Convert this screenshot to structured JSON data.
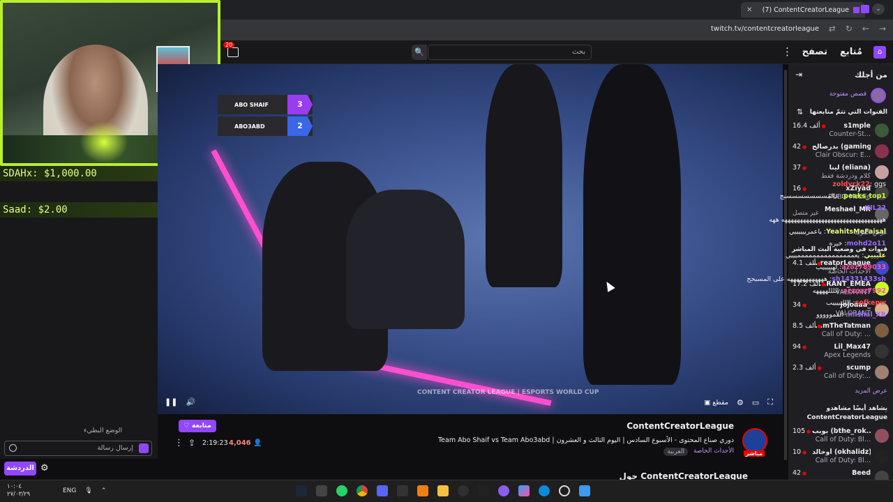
{
  "browser": {
    "tab_title": "(7) ContentCreatorLeague",
    "url": "twitch.tv/contentcreatorleague"
  },
  "topnav": {
    "following": "مُتابع",
    "browse": "تصفح",
    "search_placeholder": "بحث",
    "notif_count": "20"
  },
  "overlay": {
    "donation1": "SDAHx: $1,000.00",
    "donation2": "Saad: $2.00"
  },
  "scoreboard": [
    {
      "team": "ABO SHAIF",
      "score": "3"
    },
    {
      "team": "ABO3ABD",
      "score": "2"
    }
  ],
  "chat": {
    "messages": [
      {
        "user": "zoldyck22",
        "text": "ggs",
        "color": "#ff4f4f"
      },
      {
        "user": "peaks_top1",
        "text": "عالمسسسسسسسبح",
        "color": "#c8ff40"
      },
      {
        "user": "INL22",
        "text": "",
        "color": "#9b6bff"
      },
      {
        "user": "",
        "text": "هههههههههههههههههههههههههههههههههه ههه",
        "color": "#efeff1"
      },
      {
        "user": "YeahitsMeFaisal",
        "text": "ياعمرييييييي",
        "color": "#e6ff80"
      },
      {
        "user": "mohd2o11",
        "text": "خيره",
        "color": "#9b6bff"
      },
      {
        "user": "عليييي",
        "text": "يعممممممممممممممميييي",
        "color": "#e6ff80"
      },
      {
        "user": "azoz789033",
        "text": "لهيييييب",
        "color": "#ff4fa8"
      },
      {
        "user": "sh14331433sh",
        "text": "ههههههههههههه على المسبحح",
        "color": "#9b6bff"
      },
      {
        "user": "azzozz7992",
        "text": "اللللههههه",
        "color": "#ff4fa8"
      },
      {
        "user": "sofkepw",
        "text": "اللليييييب",
        "color": "#ff4f4f"
      },
      {
        "user": "mishal_XR",
        "text": "القمووووو",
        "color": "#9b6bff"
      }
    ],
    "mode_label": "الوضع البطيء",
    "input_placeholder": "إرسال رسالة",
    "chat_button": "الدردشة"
  },
  "player": {
    "clip_label": "مقطع",
    "watermark": "CONTENT CREATOR LEAGUE | ESPORTS WORLD CUP"
  },
  "stream": {
    "channel": "ContentCreatorLeague",
    "title": "دوري صناع المحتوى - الأسبوع السادس | اليوم الثالث و العشرون | Team Abo Shaif vs Team Abo3abd",
    "category": "الأحداث الخاصة",
    "tag": "العربية",
    "live_badge": "مباشر",
    "follow_label": "متابعة",
    "viewers": "4,046",
    "uptime": "2:19:23",
    "about": "حول ContentCreatorLeague"
  },
  "sidebar": {
    "for_you": "من أجلك",
    "open_stories": "قصص مفتوحة",
    "followed_heading": "القنوات التي تتمّ متابعتها",
    "followed": [
      {
        "name": "s1mple",
        "game": "Counter-St...",
        "viewers": "16.4 ألف",
        "color": "#3a5a3a"
      },
      {
        "name": "بدرصالح (gaming)...",
        "game": "Clair Obscur: E...",
        "viewers": "42",
        "color": "#8a3050"
      },
      {
        "name": "لينا (eliana)",
        "game": "كلام ودردشة فقط",
        "viewers": "37",
        "color": "#c8a0a0"
      },
      {
        "name": "xZiyad",
        "game": "PUBG Mobile",
        "viewers": "16",
        "color": "#444"
      },
      {
        "name": "Meshael_MR",
        "game": "",
        "viewers": "",
        "offline": "غير متصل",
        "color": "#666"
      }
    ],
    "show_more": "عرض المزيد",
    "live_heading": "قنوات في وضعية البث المباشر",
    "live": [
      {
        "name": "...reatorLeague",
        "game": "الأحداث الخاصة",
        "viewers": "4.1 ألف",
        "color": "#3a4ad0"
      },
      {
        "name": "...RANT_EMEA",
        "game": "VALORANT",
        "viewers": "17.2 ألف",
        "color": "#c8ff20"
      },
      {
        "name": "jojoaaa_",
        "game": "VALORANT",
        "viewers": "34",
        "color": "#d8b090"
      },
      {
        "name": "...mTheTatman",
        "game": "Call of Duty: ...",
        "viewers": "8.5 ألف",
        "color": "#7a6040"
      },
      {
        "name": "Lil_Max47",
        "game": "Apex Legends",
        "viewers": "94",
        "color": "#333"
      },
      {
        "name": "scump",
        "game": "Call of Duty:...",
        "viewers": "2.3 ألف",
        "color": "#a08070"
      }
    ],
    "show_more2": "عرض المزيد",
    "also_watch": "يشاهد أيضًا مشاهدو ContentCreatorLeague",
    "also": [
      {
        "name": "بوبب (bthe_rok...",
        "game": "Call of Duty: Bl...",
        "viewers": "105",
        "color": "#905060"
      },
      {
        "name": "أوخالد (okhalidz)",
        "game": "Call of Duty: Bl...",
        "viewers": "10",
        "color": "#222"
      },
      {
        "name": "Beed",
        "game": "",
        "viewers": "42",
        "color": "#444"
      }
    ]
  },
  "taskbar": {
    "time": "١٠:٠٤",
    "date": "٢٧/٠٣/٢٩",
    "lang": "ENG"
  }
}
